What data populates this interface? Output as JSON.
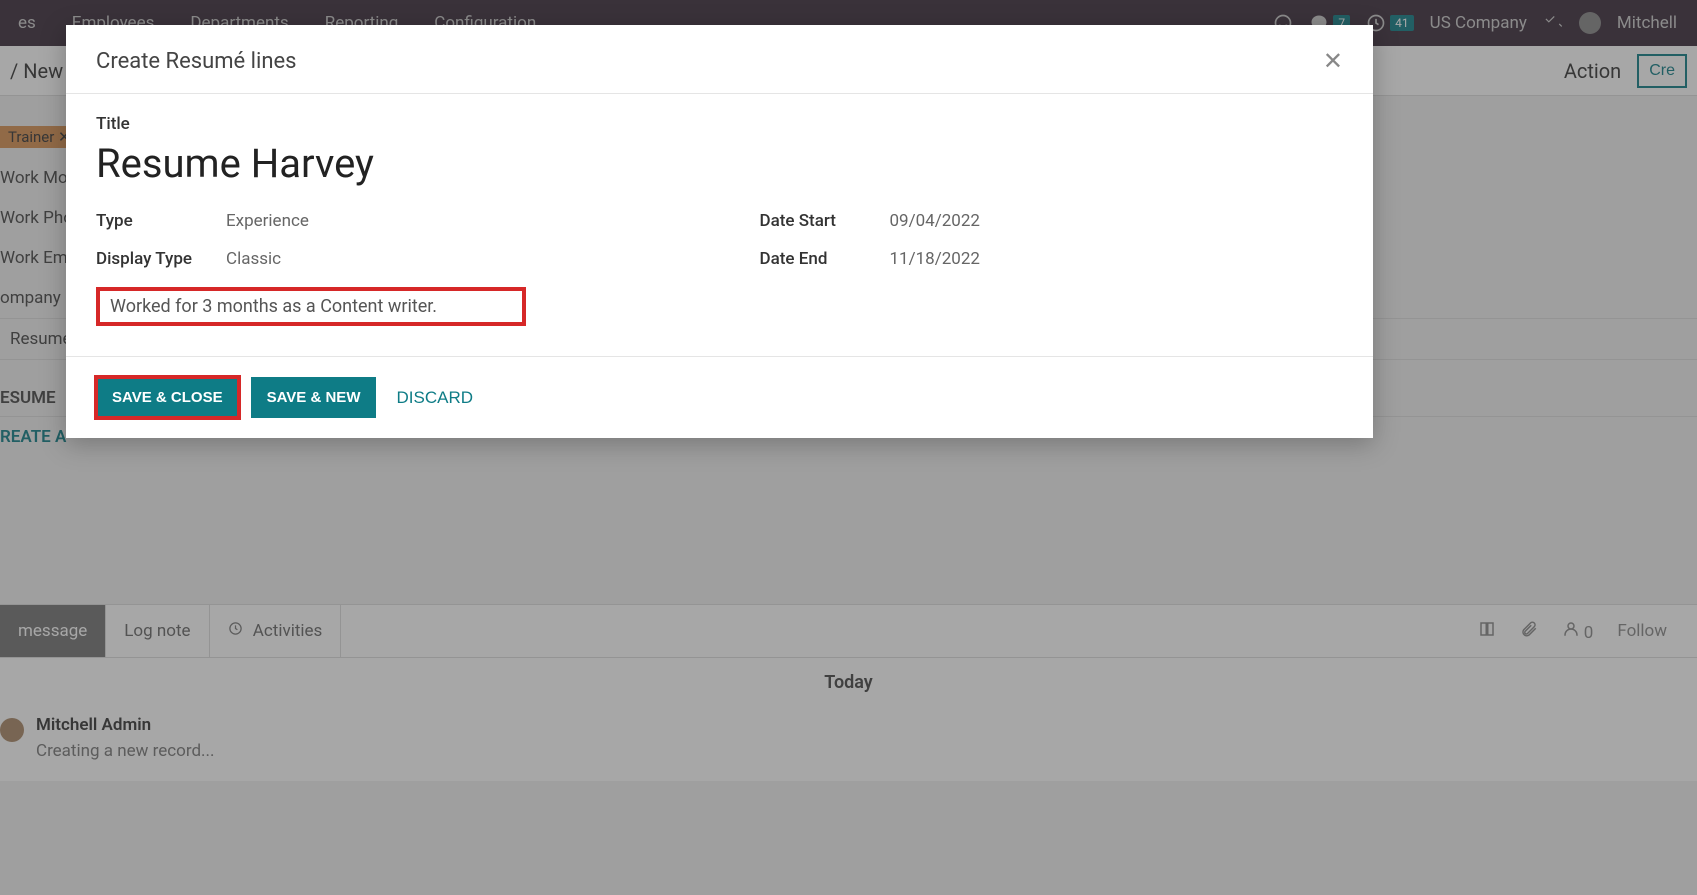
{
  "topbar": {
    "menu_es": "es",
    "menu_employees": "Employees",
    "menu_departments": "Departments",
    "menu_reporting": "Reporting",
    "menu_configuration": "Configuration",
    "chat_count": "7",
    "clock_count": "41",
    "company": "US Company",
    "user": "Mitchell"
  },
  "breadcrumb": {
    "path": "/ New",
    "action": "Action",
    "create": "Cre"
  },
  "bg": {
    "tag": "Trainer",
    "work_mobile": "Work Mo",
    "work_phone": "Work Pho",
    "work_email": "Work Em",
    "company": "ompany",
    "resume_tab": "Resumé",
    "section": "ESUME",
    "create_link": "REATE A"
  },
  "modal": {
    "header": "Create Resumé lines",
    "title_label": "Title",
    "title_value": "Resume Harvey",
    "type_label": "Type",
    "type_value": "Experience",
    "display_type_label": "Display Type",
    "display_type_value": "Classic",
    "date_start_label": "Date Start",
    "date_start_value": "09/04/2022",
    "date_end_label": "Date End",
    "date_end_value": "11/18/2022",
    "description": "Worked for 3 months as a Content writer.",
    "save_close": "SAVE & CLOSE",
    "save_new": "SAVE & NEW",
    "discard": "DISCARD"
  },
  "chatter": {
    "tab_message": "message",
    "tab_lognote": "Log note",
    "tab_activities": "Activities",
    "follower_count": "0",
    "follow": "Follow",
    "today": "Today",
    "author": "Mitchell Admin",
    "msg_body": "Creating a new record..."
  }
}
